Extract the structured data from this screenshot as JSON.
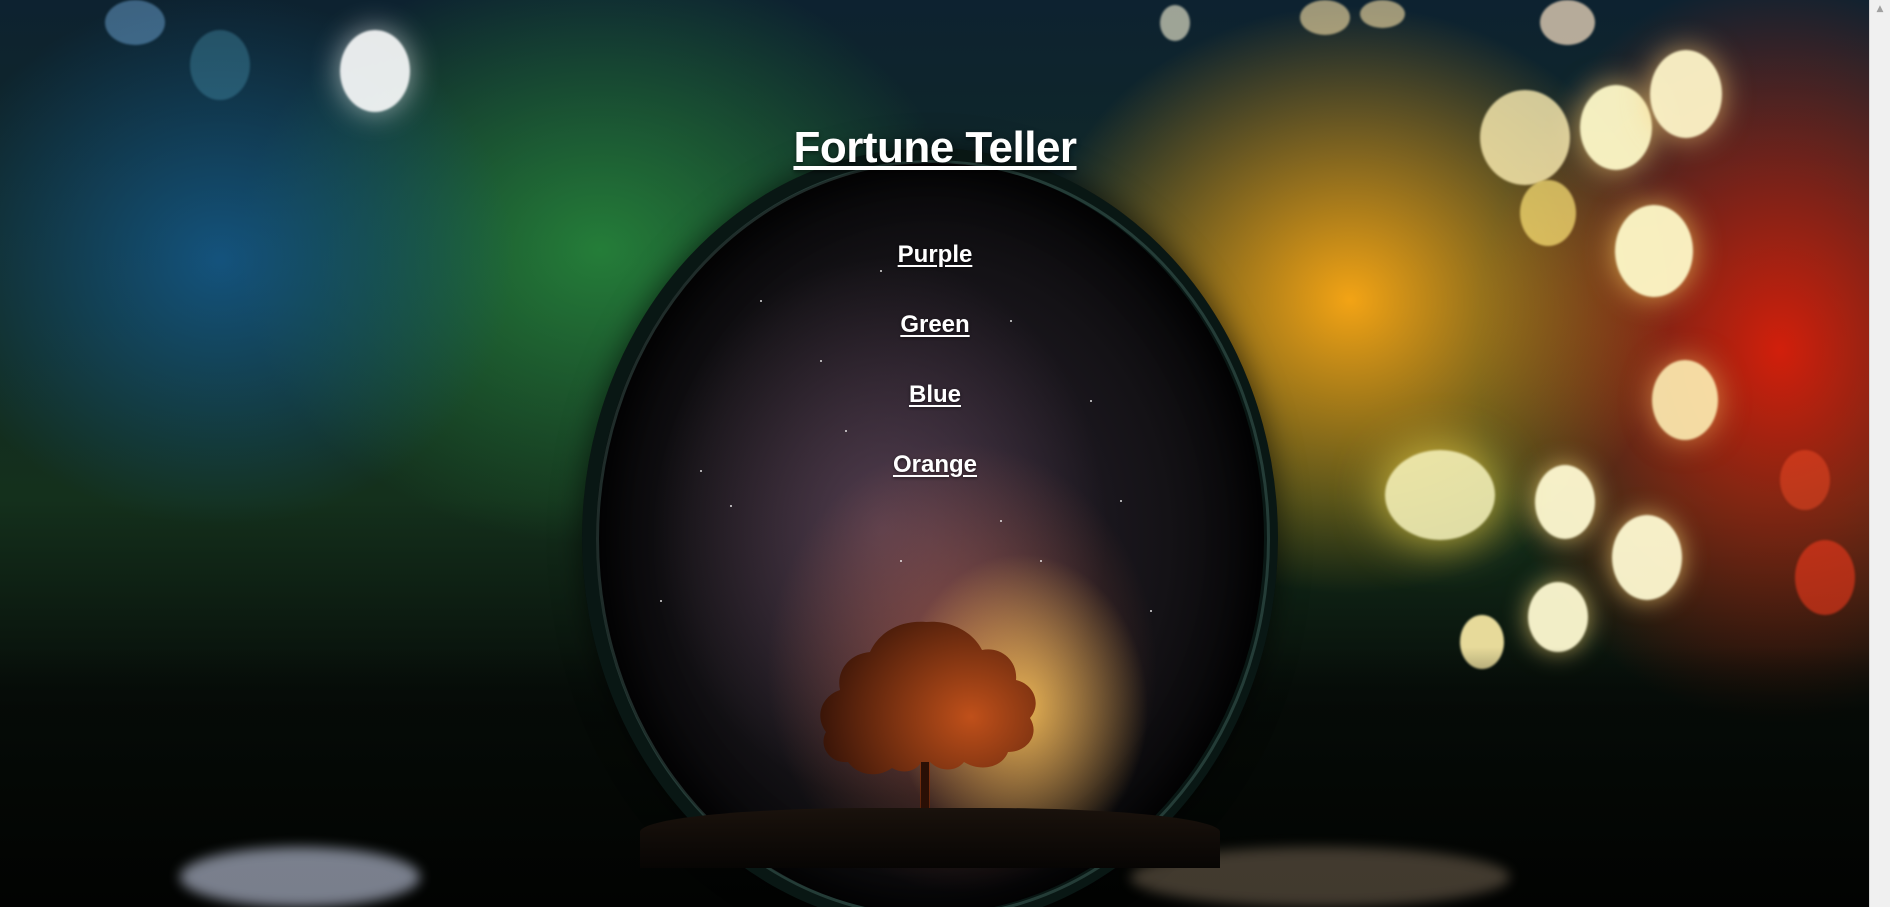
{
  "page": {
    "title": "Fortune Teller"
  },
  "choices": [
    {
      "label": "Purple"
    },
    {
      "label": "Green"
    },
    {
      "label": "Blue"
    },
    {
      "label": "Orange"
    }
  ],
  "background": {
    "description_icon": "crystal-ball-tree-bokeh-image"
  },
  "scrollbar": {
    "up_icon": "scroll-up-arrow-icon"
  }
}
